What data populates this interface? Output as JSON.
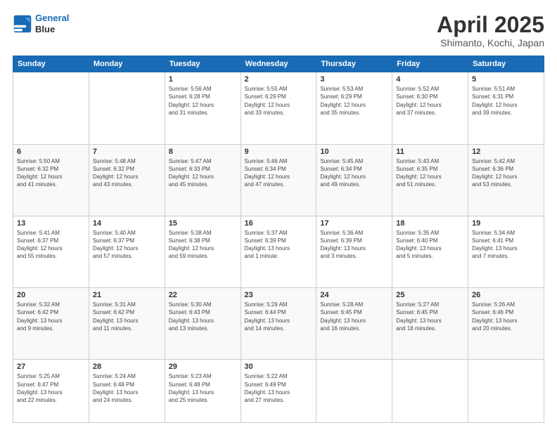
{
  "header": {
    "logo_line1": "General",
    "logo_line2": "Blue",
    "title": "April 2025",
    "subtitle": "Shimanto, Kochi, Japan"
  },
  "weekdays": [
    "Sunday",
    "Monday",
    "Tuesday",
    "Wednesday",
    "Thursday",
    "Friday",
    "Saturday"
  ],
  "weeks": [
    [
      {
        "day": "",
        "info": ""
      },
      {
        "day": "",
        "info": ""
      },
      {
        "day": "1",
        "info": "Sunrise: 5:56 AM\nSunset: 6:28 PM\nDaylight: 12 hours\nand 31 minutes."
      },
      {
        "day": "2",
        "info": "Sunrise: 5:55 AM\nSunset: 6:29 PM\nDaylight: 12 hours\nand 33 minutes."
      },
      {
        "day": "3",
        "info": "Sunrise: 5:53 AM\nSunset: 6:29 PM\nDaylight: 12 hours\nand 35 minutes."
      },
      {
        "day": "4",
        "info": "Sunrise: 5:52 AM\nSunset: 6:30 PM\nDaylight: 12 hours\nand 37 minutes."
      },
      {
        "day": "5",
        "info": "Sunrise: 5:51 AM\nSunset: 6:31 PM\nDaylight: 12 hours\nand 39 minutes."
      }
    ],
    [
      {
        "day": "6",
        "info": "Sunrise: 5:50 AM\nSunset: 6:32 PM\nDaylight: 12 hours\nand 41 minutes."
      },
      {
        "day": "7",
        "info": "Sunrise: 5:48 AM\nSunset: 6:32 PM\nDaylight: 12 hours\nand 43 minutes."
      },
      {
        "day": "8",
        "info": "Sunrise: 5:47 AM\nSunset: 6:33 PM\nDaylight: 12 hours\nand 45 minutes."
      },
      {
        "day": "9",
        "info": "Sunrise: 5:46 AM\nSunset: 6:34 PM\nDaylight: 12 hours\nand 47 minutes."
      },
      {
        "day": "10",
        "info": "Sunrise: 5:45 AM\nSunset: 6:34 PM\nDaylight: 12 hours\nand 49 minutes."
      },
      {
        "day": "11",
        "info": "Sunrise: 5:43 AM\nSunset: 6:35 PM\nDaylight: 12 hours\nand 51 minutes."
      },
      {
        "day": "12",
        "info": "Sunrise: 5:42 AM\nSunset: 6:36 PM\nDaylight: 12 hours\nand 53 minutes."
      }
    ],
    [
      {
        "day": "13",
        "info": "Sunrise: 5:41 AM\nSunset: 6:37 PM\nDaylight: 12 hours\nand 55 minutes."
      },
      {
        "day": "14",
        "info": "Sunrise: 5:40 AM\nSunset: 6:37 PM\nDaylight: 12 hours\nand 57 minutes."
      },
      {
        "day": "15",
        "info": "Sunrise: 5:38 AM\nSunset: 6:38 PM\nDaylight: 12 hours\nand 59 minutes."
      },
      {
        "day": "16",
        "info": "Sunrise: 5:37 AM\nSunset: 6:39 PM\nDaylight: 13 hours\nand 1 minute."
      },
      {
        "day": "17",
        "info": "Sunrise: 5:36 AM\nSunset: 6:39 PM\nDaylight: 13 hours\nand 3 minutes."
      },
      {
        "day": "18",
        "info": "Sunrise: 5:35 AM\nSunset: 6:40 PM\nDaylight: 13 hours\nand 5 minutes."
      },
      {
        "day": "19",
        "info": "Sunrise: 5:34 AM\nSunset: 6:41 PM\nDaylight: 13 hours\nand 7 minutes."
      }
    ],
    [
      {
        "day": "20",
        "info": "Sunrise: 5:32 AM\nSunset: 6:42 PM\nDaylight: 13 hours\nand 9 minutes."
      },
      {
        "day": "21",
        "info": "Sunrise: 5:31 AM\nSunset: 6:42 PM\nDaylight: 13 hours\nand 11 minutes."
      },
      {
        "day": "22",
        "info": "Sunrise: 5:30 AM\nSunset: 6:43 PM\nDaylight: 13 hours\nand 13 minutes."
      },
      {
        "day": "23",
        "info": "Sunrise: 5:29 AM\nSunset: 6:44 PM\nDaylight: 13 hours\nand 14 minutes."
      },
      {
        "day": "24",
        "info": "Sunrise: 5:28 AM\nSunset: 6:45 PM\nDaylight: 13 hours\nand 16 minutes."
      },
      {
        "day": "25",
        "info": "Sunrise: 5:27 AM\nSunset: 6:45 PM\nDaylight: 13 hours\nand 18 minutes."
      },
      {
        "day": "26",
        "info": "Sunrise: 5:26 AM\nSunset: 6:46 PM\nDaylight: 13 hours\nand 20 minutes."
      }
    ],
    [
      {
        "day": "27",
        "info": "Sunrise: 5:25 AM\nSunset: 6:47 PM\nDaylight: 13 hours\nand 22 minutes."
      },
      {
        "day": "28",
        "info": "Sunrise: 5:24 AM\nSunset: 6:48 PM\nDaylight: 13 hours\nand 24 minutes."
      },
      {
        "day": "29",
        "info": "Sunrise: 5:23 AM\nSunset: 6:48 PM\nDaylight: 13 hours\nand 25 minutes."
      },
      {
        "day": "30",
        "info": "Sunrise: 5:22 AM\nSunset: 6:49 PM\nDaylight: 13 hours\nand 27 minutes."
      },
      {
        "day": "",
        "info": ""
      },
      {
        "day": "",
        "info": ""
      },
      {
        "day": "",
        "info": ""
      }
    ]
  ]
}
